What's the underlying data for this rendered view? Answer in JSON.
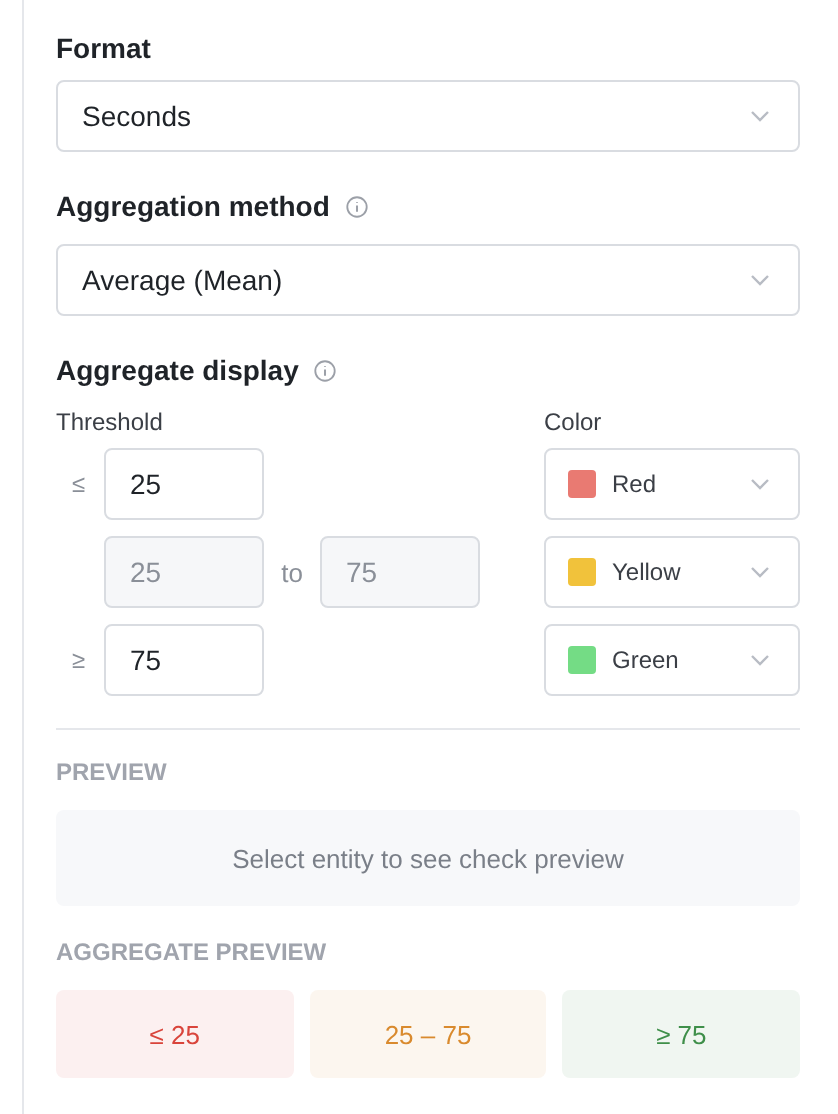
{
  "format": {
    "label": "Format",
    "value": "Seconds"
  },
  "aggregation": {
    "label": "Aggregation method",
    "value": "Average (Mean)"
  },
  "aggregate_display": {
    "label": "Aggregate display",
    "threshold_header": "Threshold",
    "color_header": "Color",
    "rows": [
      {
        "kind": "le",
        "symbol": "≤",
        "value": "25",
        "disabled": false,
        "color_name": "Red",
        "color": "#e97a72"
      },
      {
        "kind": "range",
        "from": "25",
        "separator": "to",
        "to": "75",
        "disabled": true,
        "color_name": "Yellow",
        "color": "#f1c23b"
      },
      {
        "kind": "ge",
        "symbol": "≥",
        "value": "75",
        "disabled": false,
        "color_name": "Green",
        "color": "#74dc85"
      }
    ]
  },
  "preview": {
    "label": "PREVIEW",
    "message": "Select entity to see check preview"
  },
  "aggregate_preview": {
    "label": "AGGREGATE PREVIEW",
    "tiles": [
      {
        "text": "≤ 25",
        "color": "#d9443b"
      },
      {
        "text": "25 – 75",
        "color": "#d98a2e"
      },
      {
        "text": "≥ 75",
        "color": "#3f8f4a"
      }
    ]
  }
}
